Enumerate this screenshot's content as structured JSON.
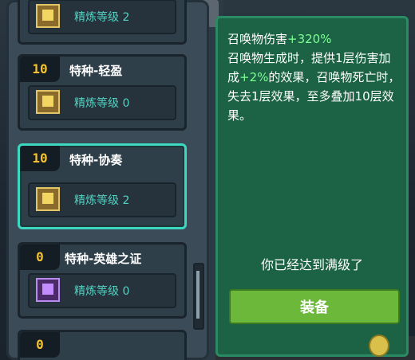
{
  "list": {
    "cards": [
      {
        "level": "",
        "title": "",
        "sub": "精炼等级 2",
        "icon": "gold-weapon-icon",
        "selected": false
      },
      {
        "level": "10",
        "title": "特种-轻盈",
        "sub": "精炼等级 0",
        "icon": "gold-weapon-icon",
        "selected": false
      },
      {
        "level": "10",
        "title": "特种-协奏",
        "sub": "精炼等级 2",
        "icon": "gold-weapon-icon",
        "selected": true
      },
      {
        "level": "0",
        "title": "特种-英雄之证",
        "sub": "精炼等级 0",
        "icon": "purple-emblem-icon",
        "selected": false
      },
      {
        "level": "0",
        "title": "",
        "sub": "",
        "icon": "",
        "selected": false
      }
    ]
  },
  "detail": {
    "line1_prefix": "召唤物伤害",
    "line1_value": "+320%",
    "desc_a": "召唤物生成时，提供1层伤害加成",
    "desc_value": "+2%",
    "desc_b": "的效果，召唤物死亡时，失去1层效果，至多叠加10层效果。",
    "status": "你已经达到满级了",
    "equip_label": "装备"
  },
  "colors": {
    "accent_teal": "#3dd7c2",
    "level_gold": "#f2c230",
    "highlight_green": "#7dff92",
    "button_green": "#6bb83a"
  }
}
